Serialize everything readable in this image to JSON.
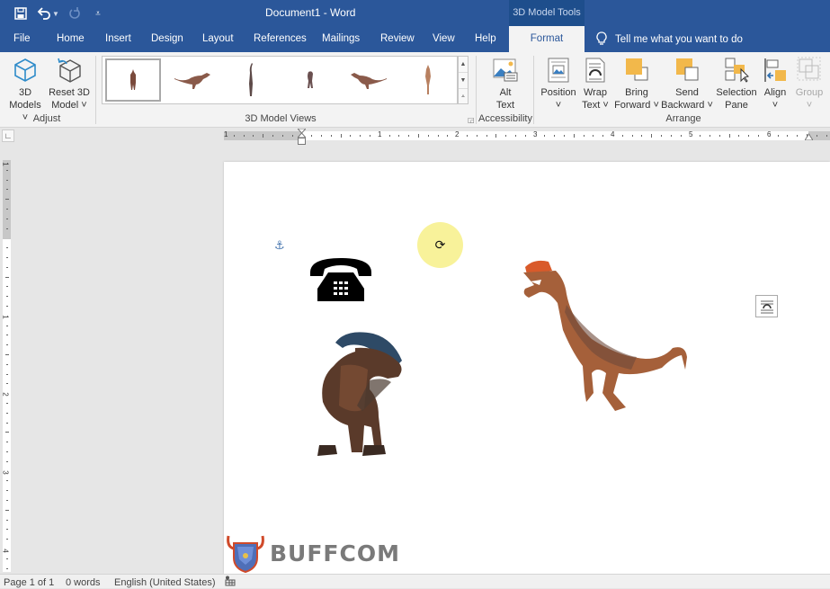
{
  "window": {
    "title": "Document1  -  Word",
    "context_tab_group": "3D Model Tools"
  },
  "qat": {
    "save": "save-icon",
    "undo": "undo-icon",
    "redo": "redo-icon",
    "customize": "customize-qat-icon"
  },
  "tabs": [
    {
      "label": "File"
    },
    {
      "label": "Home"
    },
    {
      "label": "Insert"
    },
    {
      "label": "Design"
    },
    {
      "label": "Layout"
    },
    {
      "label": "References"
    },
    {
      "label": "Mailings"
    },
    {
      "label": "Review"
    },
    {
      "label": "View"
    },
    {
      "label": "Help"
    },
    {
      "label": "Format",
      "active": true
    }
  ],
  "tell_me": {
    "placeholder": "Tell me what you want to do"
  },
  "ribbon": {
    "adjust": {
      "label": "Adjust",
      "models": {
        "line1": "3D",
        "line2": "Models ˅"
      },
      "reset": {
        "line1": "Reset 3D",
        "line2": "Model ˅"
      }
    },
    "views": {
      "label": "3D Model Views",
      "items": [
        "front",
        "side-left",
        "top",
        "back",
        "side-right",
        "below"
      ],
      "selected_index": 0
    },
    "accessibility": {
      "label": "Accessibility",
      "alt_text": {
        "line1": "Alt",
        "line2": "Text"
      }
    },
    "arrange": {
      "label": "Arrange",
      "position": {
        "line1": "Position",
        "line2": "˅"
      },
      "wrap": {
        "line1": "Wrap",
        "line2": "Text ˅"
      },
      "bring": {
        "line1": "Bring",
        "line2": "Forward ˅"
      },
      "send": {
        "line1": "Send",
        "line2": "Backward ˅"
      },
      "selection": {
        "line1": "Selection",
        "line2": "Pane"
      },
      "align": {
        "line1": "Align",
        "line2": "˅"
      },
      "group": {
        "line1": "Group",
        "line2": "˅",
        "disabled": true
      }
    }
  },
  "ruler": {
    "horizontal_labels": [
      "1",
      "1",
      "2",
      "3",
      "4",
      "5",
      "6"
    ],
    "vertical_labels": [
      "1",
      "1",
      "2",
      "3",
      "4"
    ]
  },
  "document": {
    "objects": [
      "telephone-icon",
      "parasaurolophus-3d-model",
      "dilophosaurus-3d-model"
    ],
    "rotate_symbol": "⟳",
    "anchor_symbol": "⚓"
  },
  "watermark": {
    "text": "BUFFCOM"
  },
  "status": {
    "page": "Page 1 of 1",
    "words": "0 words",
    "language": "English (United States)"
  },
  "colors": {
    "brand": "#2b579a",
    "ribbon_bg": "#f3f3f3",
    "rotate_highlight": "#f8f29a"
  }
}
